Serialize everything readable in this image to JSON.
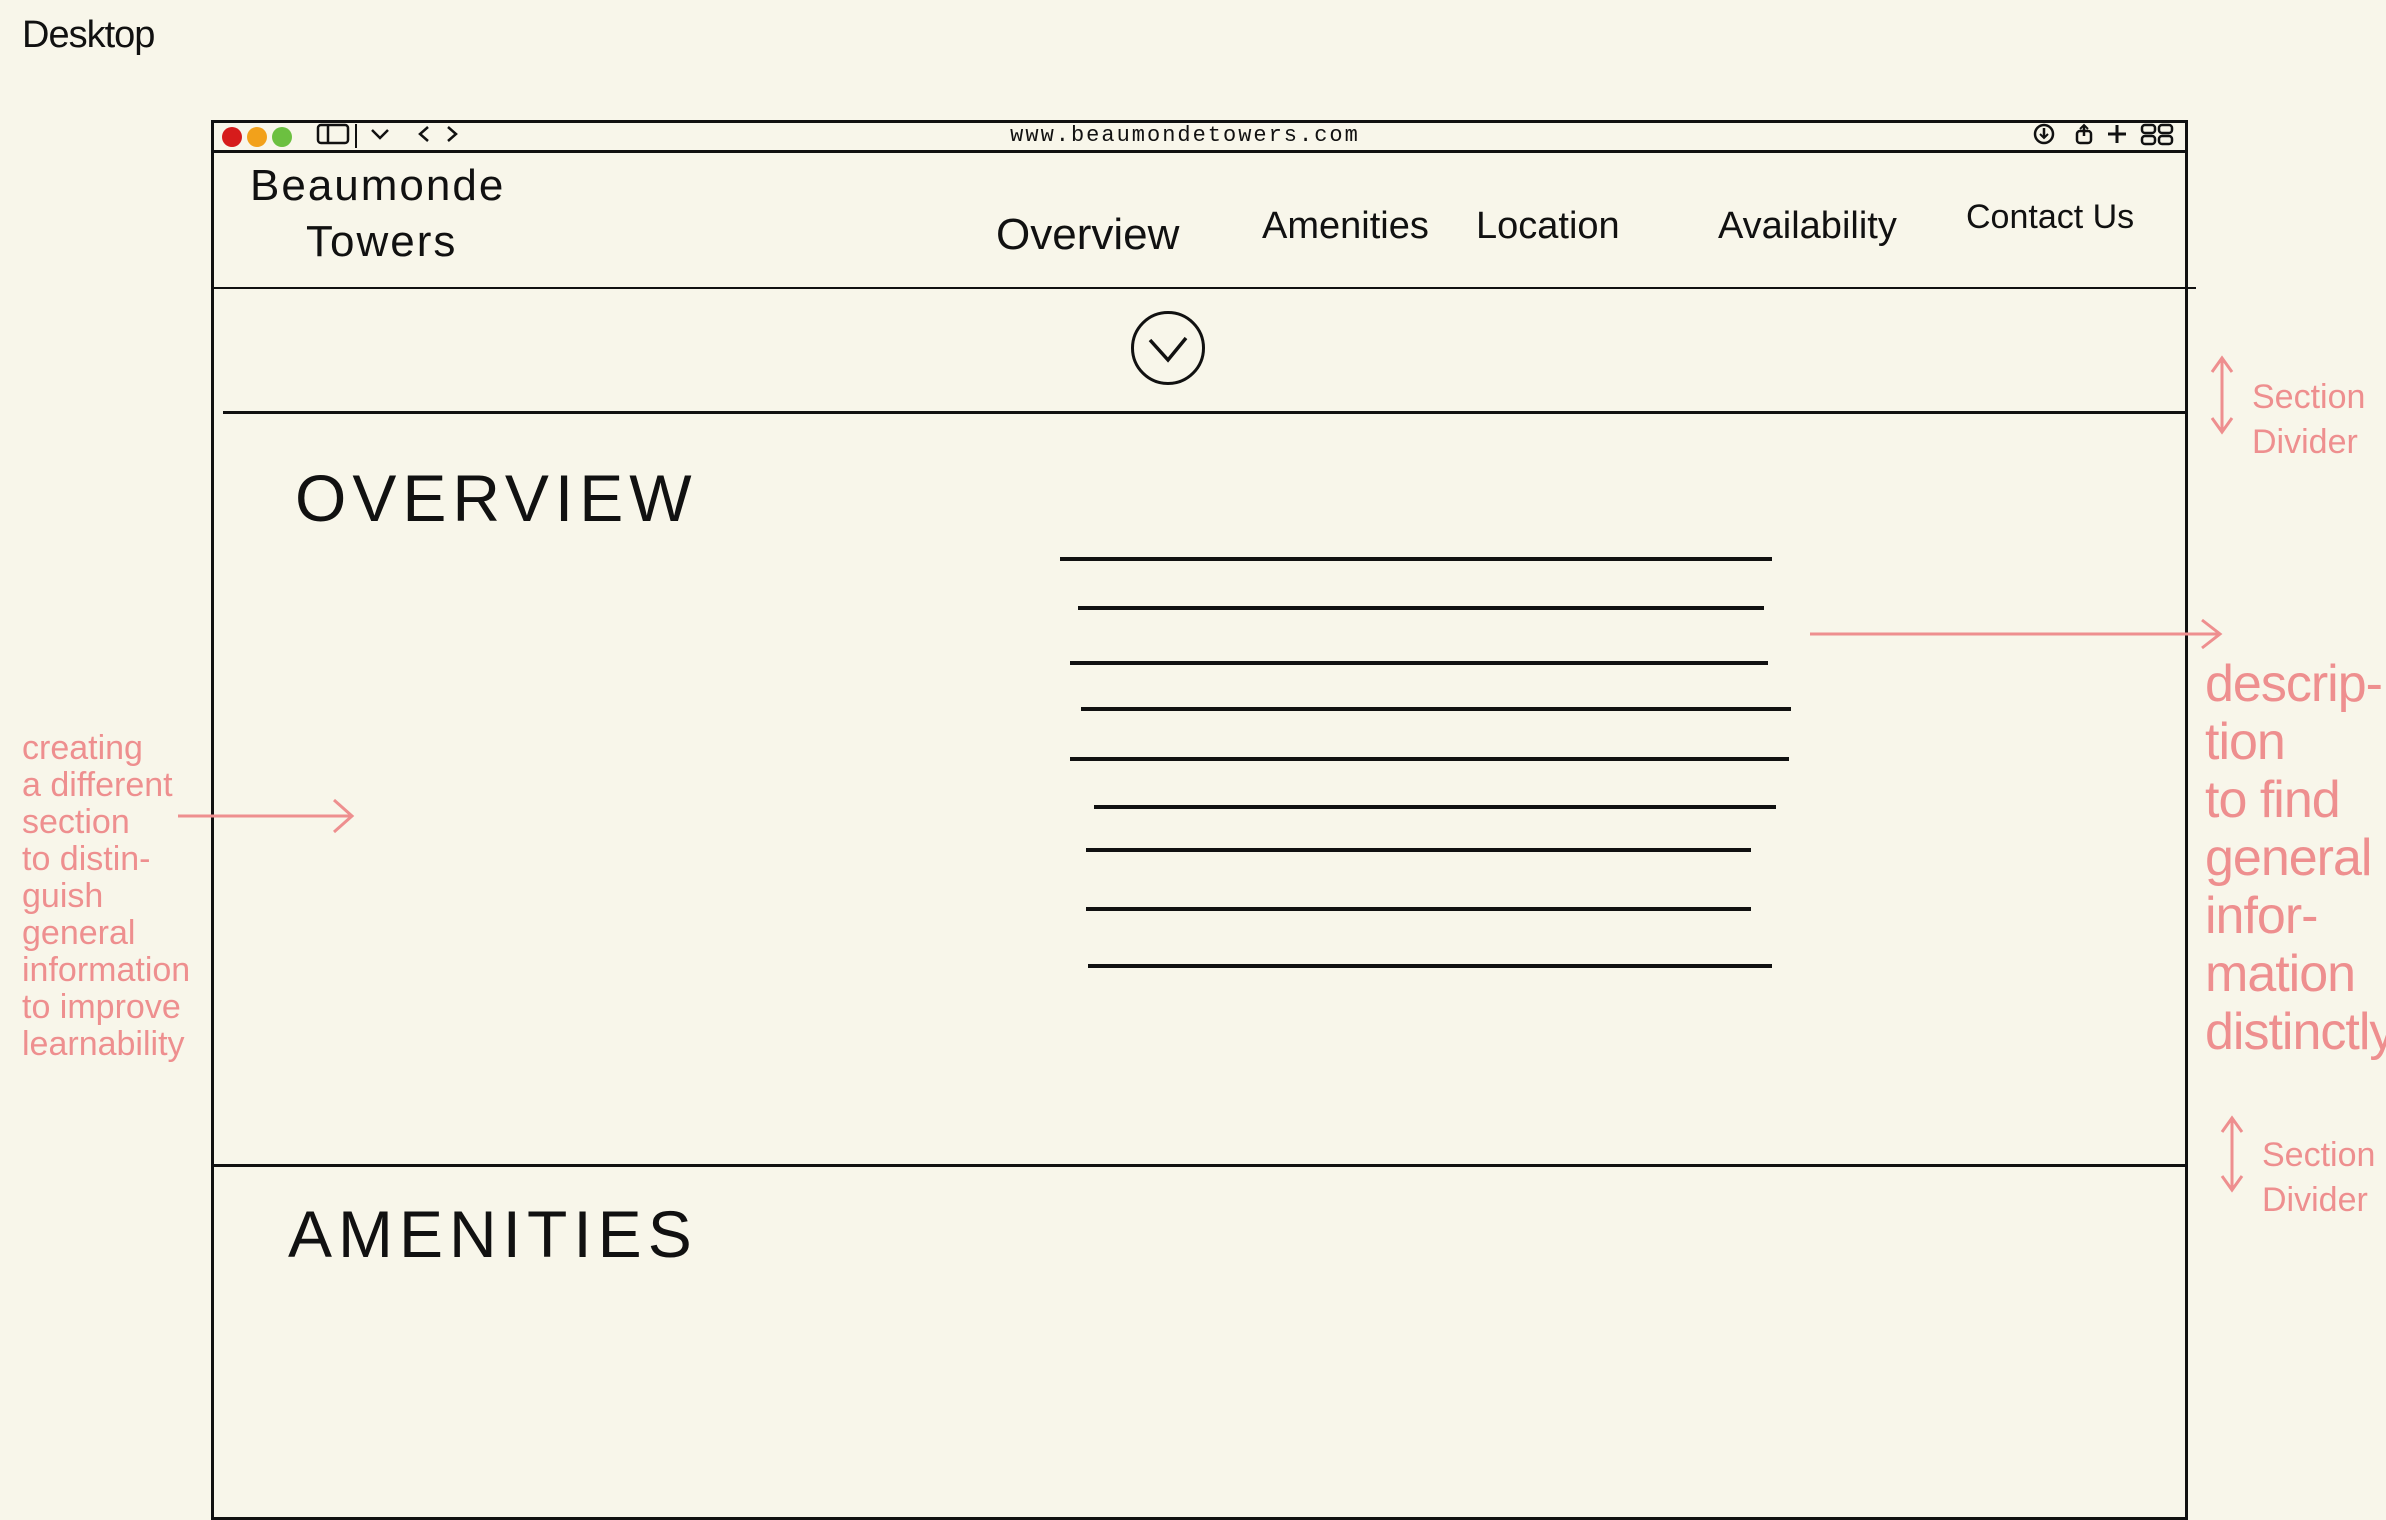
{
  "canvas_label": "Desktop",
  "browser": {
    "url": "www.beaumondetowers.com",
    "toolbar_left_icons": [
      "sidebar-icon",
      "chevron-down-icon",
      "back-icon",
      "forward-icon"
    ],
    "toolbar_right_icons": [
      "download-icon",
      "share-icon",
      "new-tab-icon",
      "tab-overview-icon"
    ]
  },
  "site": {
    "logo_line1": "Beaumonde",
    "logo_line2": "Towers",
    "nav": [
      "Overview",
      "Amenities",
      "Location",
      "Availability",
      "Contact Us"
    ],
    "scroll_icon": "chevron-down-circle-icon"
  },
  "sections": {
    "overview_title": "OVERVIEW",
    "amenities_title": "AMENITIES",
    "overview_placeholder_lines": 9
  },
  "annotations": {
    "section_divider_top": "Section\nDivider",
    "section_divider_bottom": "Section\nDivider",
    "left_note": "creating\na different\nsection\nto distin-\nguish\ngeneral\ninformation\nto improve\nlearnability",
    "right_note": "descrip-\ntion\nto find\ngeneral\ninfor-\nmation\ndistinctly"
  },
  "colors": {
    "background": "#f8f6ea",
    "ink": "#111111",
    "annotation": "#ee8f8f",
    "traffic_red": "#d61b1b",
    "traffic_yellow": "#f2a11b",
    "traffic_green": "#6cc040"
  }
}
